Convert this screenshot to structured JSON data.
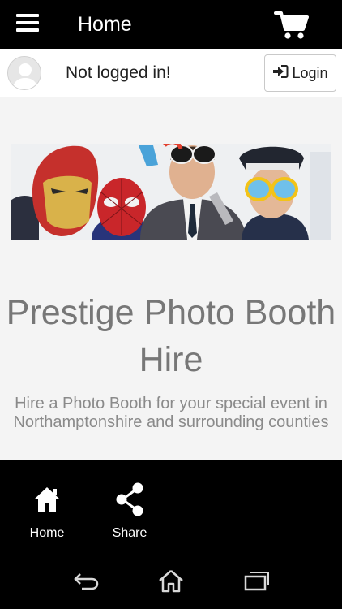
{
  "topbar": {
    "title": "Home",
    "menu_icon": "hamburger-menu-icon",
    "cart_icon": "shopping-cart-icon"
  },
  "login_bar": {
    "status": "Not logged in!",
    "login_label": "Login",
    "avatar_icon": "user-avatar-icon",
    "login_icon": "sign-in-icon"
  },
  "hero": {
    "image": "photo-booth-party-banner"
  },
  "main": {
    "title": "Prestige Photo Booth Hire",
    "description": "Hire a Photo Booth for your special event in Northamptonshire and surrounding counties"
  },
  "bottom_nav": {
    "items": [
      {
        "label": "Home",
        "icon": "home-icon"
      },
      {
        "label": "Share",
        "icon": "share-icon"
      }
    ]
  },
  "system_nav": {
    "buttons": [
      "back-icon",
      "home-outline-icon",
      "recent-apps-icon"
    ]
  },
  "colors": {
    "bar_background": "#000000",
    "content_background": "#f4f4f4",
    "title_text": "#777777"
  }
}
